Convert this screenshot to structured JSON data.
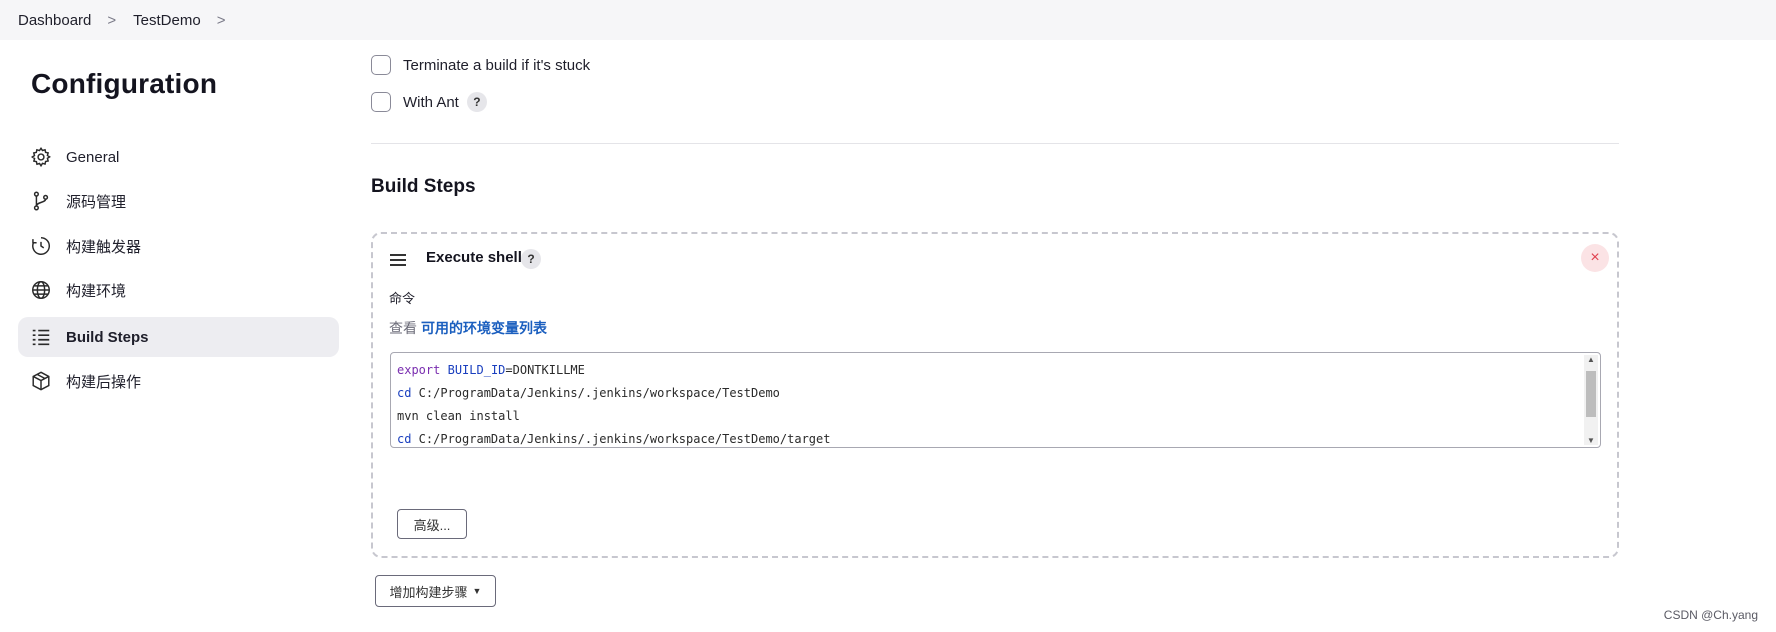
{
  "breadcrumb": {
    "items": [
      "Dashboard",
      "TestDemo"
    ],
    "separator": ">"
  },
  "sidebar": {
    "title": "Configuration",
    "items": [
      {
        "label": "General",
        "icon": "gear-icon"
      },
      {
        "label": "源码管理",
        "icon": "source-branch-icon"
      },
      {
        "label": "构建触发器",
        "icon": "clock-icon"
      },
      {
        "label": "构建环境",
        "icon": "globe-icon"
      },
      {
        "label": "Build Steps",
        "icon": "list-icon",
        "active": true
      },
      {
        "label": "构建后操作",
        "icon": "package-icon"
      }
    ]
  },
  "options": {
    "terminate_label": "Terminate a build if it's stuck",
    "with_ant_label": "With Ant",
    "help_symbol": "?"
  },
  "build_steps": {
    "title": "Build Steps",
    "step": {
      "title": "Execute shell",
      "close_symbol": "×",
      "command_label": "命令",
      "env_prefix": "查看",
      "env_link": "可用的环境变量列表",
      "code": {
        "line1_kw": "export",
        "line1_var": "BUILD_ID",
        "line1_rest": "=DONTKILLME",
        "line2_kw": "cd",
        "line2_rest": " C:/ProgramData/Jenkins/.jenkins/workspace/TestDemo",
        "line3": "mvn clean install",
        "line4_kw": "cd",
        "line4_rest": " C:/ProgramData/Jenkins/.jenkins/workspace/TestDemo/target"
      },
      "advanced_label": "高级..."
    },
    "add_step_label": "增加构建步骤"
  },
  "watermark": "CSDN @Ch.yang"
}
